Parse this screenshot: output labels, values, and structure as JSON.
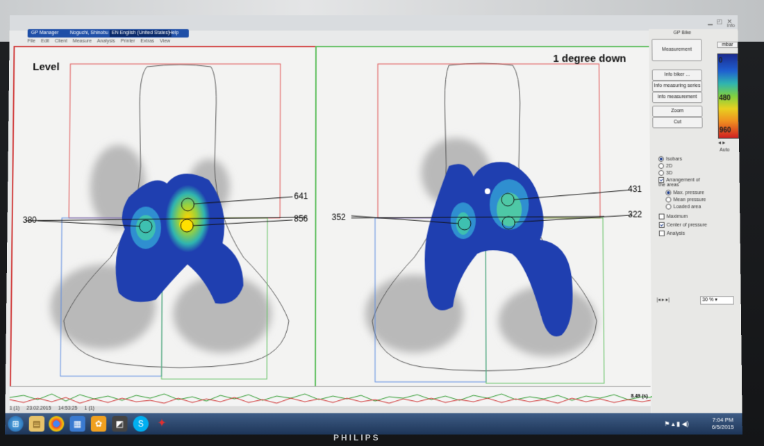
{
  "window": {
    "tabs": [
      "GP Manager",
      "Noguchi, Shinobu",
      "EN English (United States)",
      "Help"
    ],
    "topright": [
      "Info"
    ]
  },
  "menu": [
    "File",
    "Edit",
    "Client",
    "Measure",
    "Analysis",
    "Printer",
    "Extras",
    "View"
  ],
  "left_panel": {
    "label": "Level",
    "values": {
      "a": "380",
      "b": "641",
      "c": "856"
    }
  },
  "right_panel": {
    "label": "1 degree down",
    "values": {
      "a": "352",
      "b": "431",
      "c": "322"
    }
  },
  "sidebar": {
    "title": "GP Bike",
    "buttons": {
      "measurement": "Measurement",
      "info_biker": "Info biker ...",
      "info_series": "Info measuring series",
      "info_measurement": "Info measurement",
      "zoom": "Zoom",
      "cut": "Cut"
    },
    "unit": "mbar",
    "scale_ticks": [
      "0",
      "480",
      "960"
    ],
    "auto": "Auto",
    "options": {
      "isobars": "Isobars",
      "two_d": "2D",
      "three_d": "3D",
      "arrangement": "Arrangement of the areas",
      "max_pressure": "Max. pressure",
      "mean_pressure": "Mean pressure",
      "loaded_area": "Loaded area",
      "maximum": "Maximum",
      "center_of_pressure": "Center of pressure",
      "analysis": "Analysis"
    },
    "zoom_value": "30 %"
  },
  "status": {
    "count_a": "1 (1)",
    "date": "23.02.2015",
    "time": "14:53:25",
    "count_b": "1 (1)",
    "duration": "8.49 (s)"
  },
  "clock": {
    "time": "7:04 PM",
    "date": "6/5/2015"
  },
  "brand": "PHILIPS"
}
